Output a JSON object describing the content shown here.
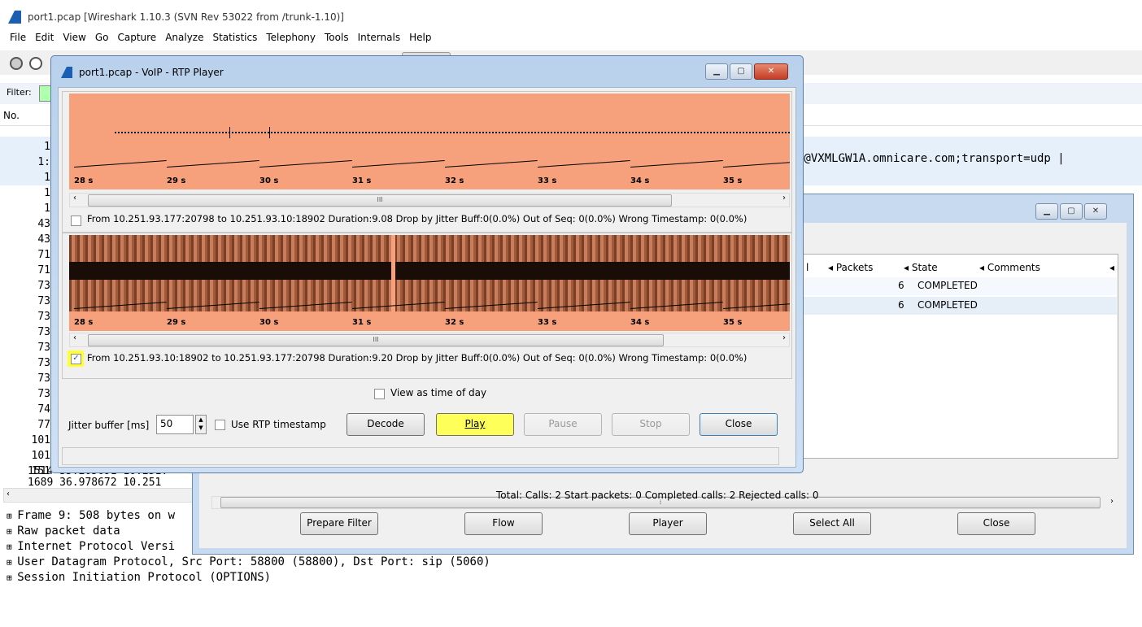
{
  "main_window": {
    "title": "port1.pcap  [Wireshark 1.10.3  (SVN Rev 53022 from /trunk-1.10)]",
    "menu": [
      "File",
      "Edit",
      "View",
      "Go",
      "Capture",
      "Analyze",
      "Statistics",
      "Telephony",
      "Tools",
      "Internals",
      "Help"
    ],
    "filter_label": "Filter:",
    "col_no": "No.",
    "row_numbers": [
      "1",
      "1:",
      "1",
      "1",
      "1",
      "43",
      "43",
      "71",
      "71",
      "73",
      "73",
      "73",
      "73",
      "73",
      "73",
      "73",
      "73",
      "74",
      "77",
      "101",
      "101",
      "151"
    ],
    "row_1514": "1514 35.205691  10.251.",
    "row_1689": "1689 36.978672  10.251",
    "sip_text": "2@VXMLGW1A.omnicare.com;transport=udp  |",
    "tree_items": [
      "Frame 9: 508 bytes on w",
      "Raw packet data",
      "Internet Protocol Versi",
      "User Datagram Protocol, Src Port: 58800 (58800), Dst Port: sip (5060)",
      "Session Initiation Protocol (OPTIONS)"
    ]
  },
  "calls_window": {
    "columns": [
      "l",
      "Packets",
      "State",
      "Comments"
    ],
    "rows": [
      {
        "packets": "6",
        "state": "COMPLETED"
      },
      {
        "packets": "6",
        "state": "COMPLETED"
      }
    ],
    "totals": "Total: Calls: 2  Start packets: 0  Completed calls: 2  Rejected calls: 0",
    "buttons": {
      "prepare_filter": "Prepare Filter",
      "flow": "Flow",
      "player": "Player",
      "select_all": "Select All",
      "close": "Close"
    }
  },
  "rtp_player": {
    "title": "port1.pcap - VoIP - RTP Player",
    "ticks": [
      "28 s",
      "29 s",
      "30 s",
      "31 s",
      "32 s",
      "33 s",
      "34 s",
      "35 s"
    ],
    "stream1": "From 10.251.93.177:20798 to 10.251.93.10:18902  Duration:9.08  Drop by Jitter Buff:0(0.0%)  Out of Seq: 0(0.0%)  Wrong Timestamp: 0(0.0%)",
    "stream2": "From 10.251.93.10:18902 to 10.251.93.177:20798  Duration:9.20  Drop by Jitter Buff:0(0.0%)  Out of Seq: 0(0.0%)  Wrong Timestamp: 0(0.0%)",
    "stream1_checked": false,
    "stream2_checked": true,
    "view_time_of_day": "View as time of day",
    "jitter_label": "Jitter buffer [ms]",
    "jitter_value": "50",
    "use_rtp_timestamp": "Use RTP timestamp",
    "buttons": {
      "decode": "Decode",
      "play": "Play",
      "pause": "Pause",
      "stop": "Stop",
      "close": "Close"
    },
    "colors": {
      "waveform_bg": "#f7a07c",
      "highlight": "#ffff33"
    }
  }
}
